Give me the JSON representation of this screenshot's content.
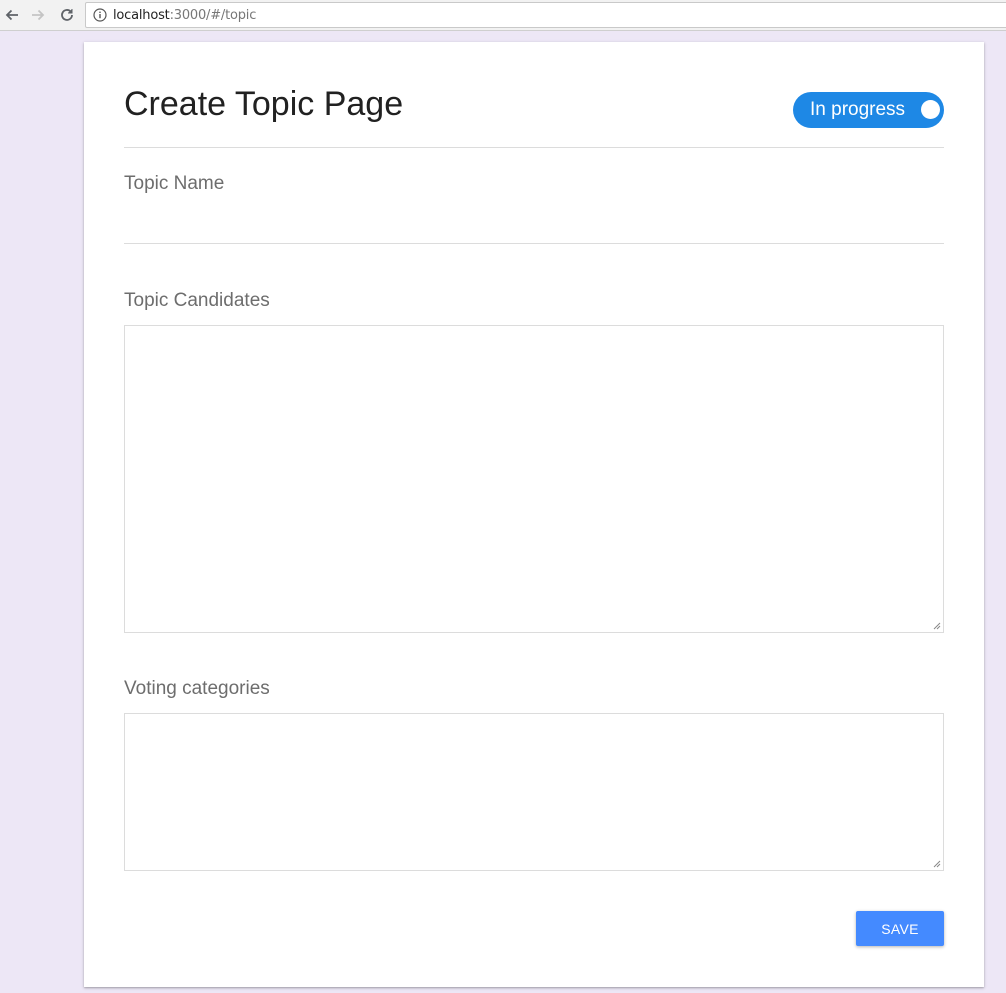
{
  "browser": {
    "url_host": "localhost",
    "url_rest": ":3000/#/topic",
    "icons": {
      "back": "arrow-left-icon",
      "forward": "arrow-right-icon",
      "reload": "reload-icon",
      "info": "info-icon"
    }
  },
  "page": {
    "title": "Create Topic Page",
    "status_toggle": {
      "label": "In progress",
      "on": true,
      "color": "#1e88e5"
    },
    "fields": {
      "topic_name": {
        "label": "Topic Name",
        "value": ""
      },
      "topic_candidates": {
        "label": "Topic Candidates",
        "value": ""
      },
      "voting_categories": {
        "label": "Voting categories",
        "value": ""
      }
    },
    "save_label": "SAVE",
    "accent_color": "#448aff",
    "background_color": "#ede7f6"
  }
}
